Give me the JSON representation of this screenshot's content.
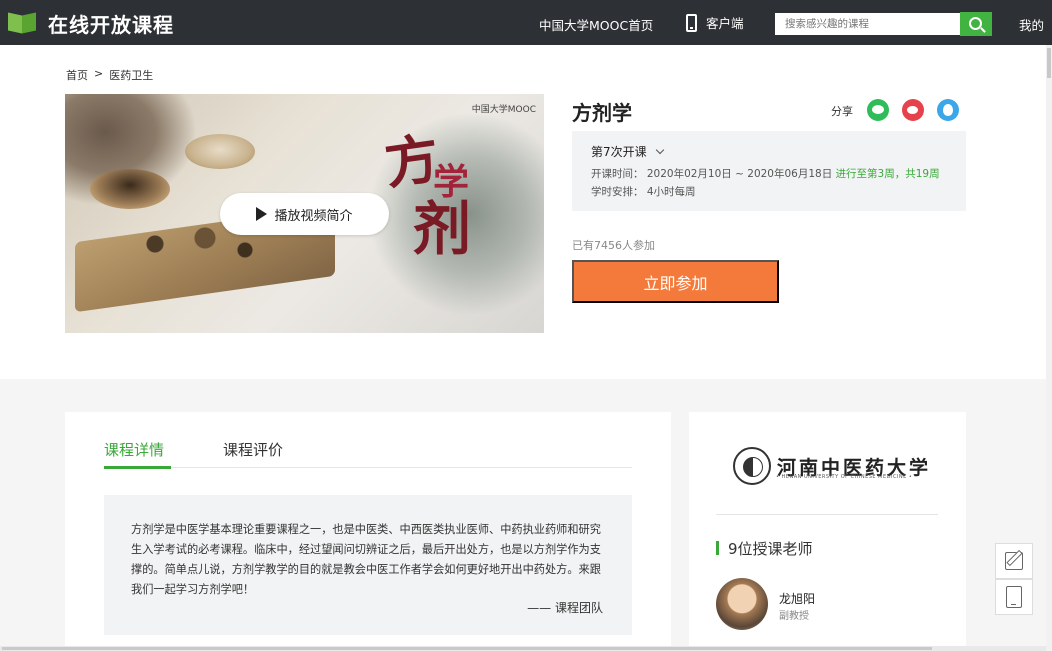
{
  "header": {
    "logo_text": "在线开放课程",
    "nav_home": "中国大学MOOC首页",
    "nav_app": "客户端",
    "search_placeholder": "搜索感兴趣的课程",
    "nav_my": "我的",
    "icons": [
      "logo-icon",
      "phone-icon",
      "search-icon"
    ]
  },
  "breadcrumb": {
    "home": "首页",
    "sep": ">",
    "category": "医药卫生"
  },
  "video": {
    "brand": "中国大学MOOC",
    "calligraphy": [
      "方",
      "学",
      "剂"
    ],
    "play_label": "播放视频简介"
  },
  "course": {
    "title": "方剂学",
    "share_label": "分享",
    "share_icons": [
      "wechat-icon",
      "weibo-icon",
      "qq-icon"
    ],
    "term": "第7次开课",
    "time_label": "开课时间：",
    "time_value": "2020年02月10日 ~ 2020年06月18日",
    "progress": "进行至第3周，共19周",
    "hours_label": "学时安排：",
    "hours_value": "4小时每周",
    "enrolled": "已有7456人参加",
    "join_label": "立即参加"
  },
  "tabs": [
    {
      "label": "课程详情",
      "active": true
    },
    {
      "label": "课程评价",
      "active": false
    }
  ],
  "intro": {
    "text": "方剂学是中医学基本理论重要课程之一，也是中医类、中西医类执业医师、中药执业药师和研究生入学考试的必考课程。临床中，经过望闻问切辨证之后，最后开出处方，也是以方剂学作为支撑的。简单点儿说，方剂学教学的目的就是教会中医工作者学会如何更好地开出中药处方。来跟我们一起学习方剂学吧！",
    "signature": "—— 课程团队"
  },
  "school": {
    "name": "河南中医药大学",
    "name_en": "• HENAN UNIVERSITY OF CHINESE MEDICINE •"
  },
  "teachers": {
    "heading": "9位授课老师",
    "list": [
      {
        "name": "龙旭阳",
        "title": "副教授"
      }
    ]
  },
  "colors": {
    "accent_green": "#39a839",
    "join_orange": "#f47a3c",
    "topbar": "#2d3035"
  }
}
